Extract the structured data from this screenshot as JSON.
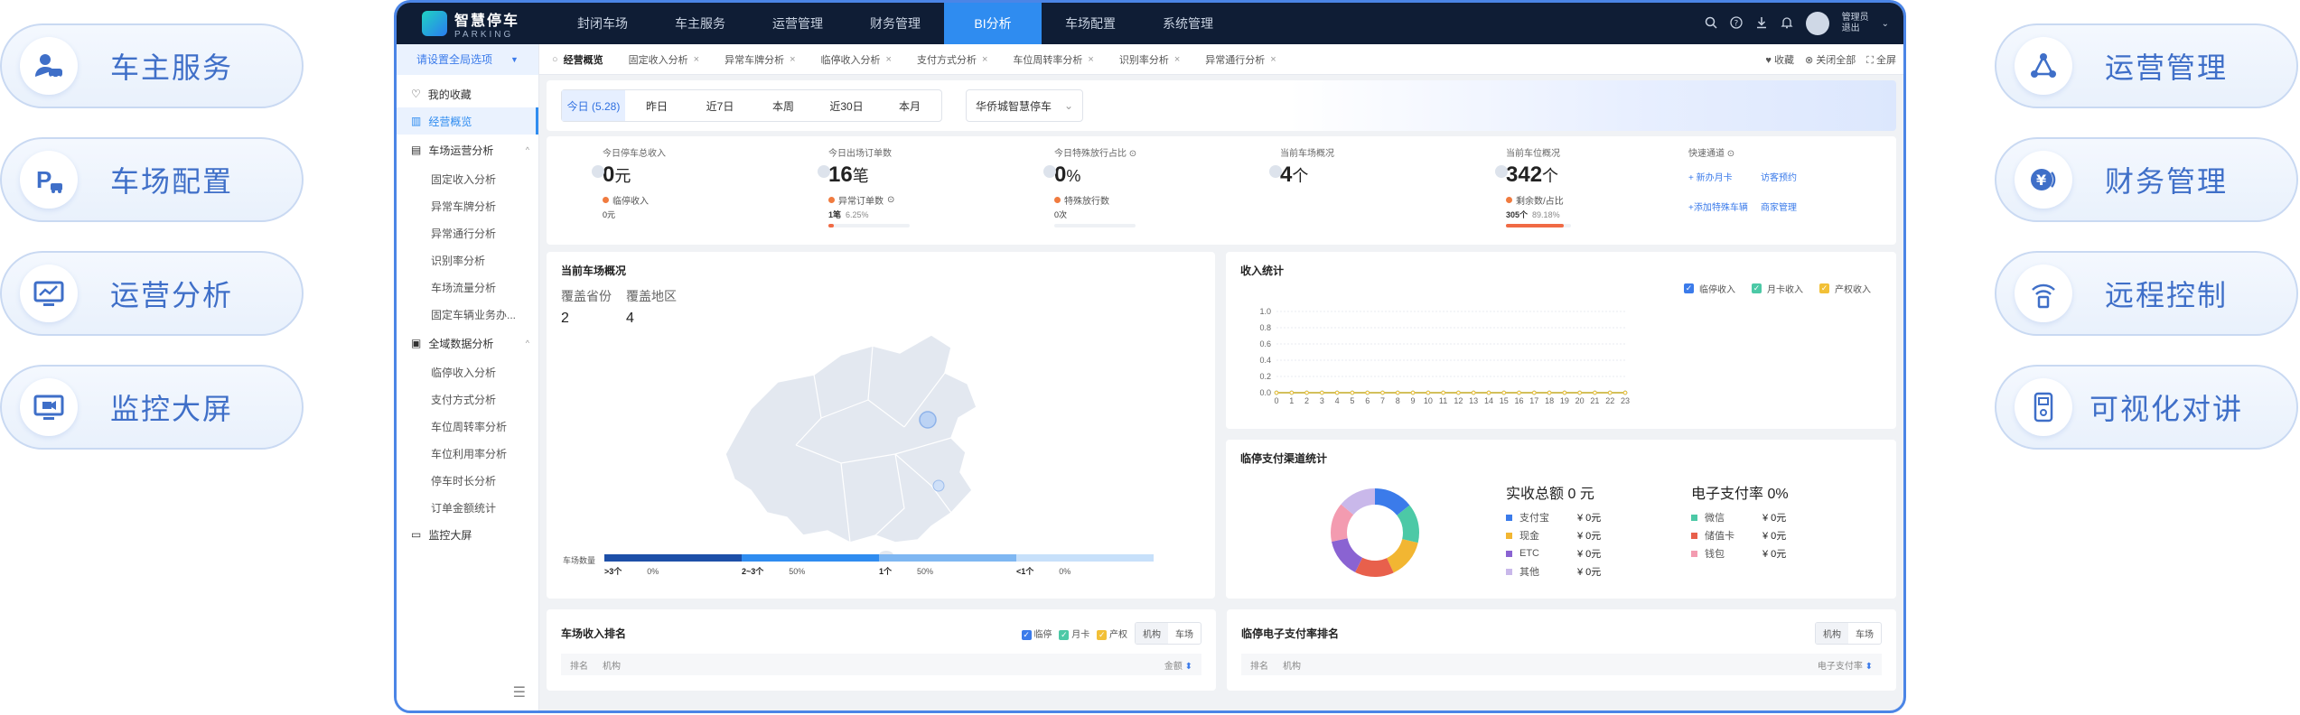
{
  "left_pills": [
    {
      "label": "车主服务",
      "icon": "user-car-icon"
    },
    {
      "label": "车场配置",
      "icon": "parking-car-icon"
    },
    {
      "label": "运营分析",
      "icon": "monitor-chart-icon"
    },
    {
      "label": "监控大屏",
      "icon": "monitor-camera-icon"
    }
  ],
  "right_pills": [
    {
      "label": "运营管理",
      "icon": "network-nodes-icon"
    },
    {
      "label": "财务管理",
      "icon": "yen-coin-icon"
    },
    {
      "label": "远程控制",
      "icon": "remote-signal-icon"
    },
    {
      "label": "可视化对讲",
      "icon": "intercom-icon"
    }
  ],
  "brand": {
    "name": "智慧停车",
    "sub": "PARKING"
  },
  "top_menu": [
    "封闭车场",
    "车主服务",
    "运营管理",
    "财务管理",
    "BI分析",
    "车场配置",
    "系统管理"
  ],
  "top_menu_active": "BI分析",
  "user": {
    "line1": "管理员",
    "line2": "退出"
  },
  "scope_select": "请设置全局选项",
  "tabs": [
    {
      "label": "经营概览",
      "active": true
    },
    {
      "label": "固定收入分析"
    },
    {
      "label": "异常车牌分析"
    },
    {
      "label": "临停收入分析"
    },
    {
      "label": "支付方式分析"
    },
    {
      "label": "车位周转率分析"
    },
    {
      "label": "识别率分析"
    },
    {
      "label": "异常通行分析"
    }
  ],
  "tab_actions": [
    "收藏",
    "关闭全部",
    "全屏"
  ],
  "sidebar": {
    "fav": "我的收藏",
    "overview": "经营概览",
    "group1": {
      "label": "车场运营分析",
      "items": [
        "固定收入分析",
        "异常车牌分析",
        "异常通行分析",
        "识别率分析",
        "车场流量分析",
        "固定车辆业务办..."
      ]
    },
    "group2": {
      "label": "全域数据分析",
      "items": [
        "临停收入分析",
        "支付方式分析",
        "车位周转率分析",
        "车位利用率分析",
        "停车时长分析",
        "订单金额统计"
      ]
    },
    "monitor": "监控大屏"
  },
  "filters": {
    "dates": [
      "今日 (5.28)",
      "昨日",
      "近7日",
      "本周",
      "近30日",
      "本月"
    ],
    "active_date": "今日 (5.28)",
    "lot": "华侨城智慧停车"
  },
  "kpis": [
    {
      "title": "今日停车总收入",
      "value": "0",
      "unit": "元",
      "sub_label": "临停收入",
      "sub_value": "0元",
      "dot": "#f07b3f"
    },
    {
      "title": "今日出场订单数",
      "value": "16",
      "unit": "笔",
      "sub_label": "异常订单数",
      "sub_value": "1笔",
      "sub_pct": "6.25%",
      "bar_pct": 6.25,
      "dot": "#f07b3f"
    },
    {
      "title": "今日特殊放行占比",
      "value": "0",
      "unit": "%",
      "sub_label": "特殊放行数",
      "sub_value": "0次",
      "dot": "#f07b3f"
    },
    {
      "title": "当前车场概况",
      "value": "4",
      "unit": "个"
    },
    {
      "title": "当前车位概况",
      "value": "342",
      "unit": "个",
      "sub_label": "剩余数/占比",
      "sub_value": "305个",
      "sub_pct": "89.18%",
      "bar_pct": 89.18,
      "dot": "#f07b3f"
    }
  ],
  "quick": {
    "title": "快速通道",
    "links": [
      "+ 新办月卡",
      "访客预约",
      "+添加特殊车辆",
      "商家管理"
    ]
  },
  "map_card": {
    "title": "当前车场概况",
    "cov_labels": [
      "覆盖省份",
      "覆盖地区"
    ],
    "cov_values": [
      "2",
      "4"
    ],
    "legend_title": "车场数量",
    "legend": [
      {
        "range": ">3个",
        "pct": "0%",
        "color": "#1d4fa8"
      },
      {
        "range": "2~3个",
        "pct": "50%",
        "color": "#2f8cf0"
      },
      {
        "range": "1个",
        "pct": "50%",
        "color": "#7fb7f2"
      },
      {
        "range": "<1个",
        "pct": "0%",
        "color": "#c7e0fa"
      }
    ]
  },
  "revenue_card": {
    "title": "收入统计",
    "legend": [
      {
        "name": "临停收入",
        "color": "#3b7bea"
      },
      {
        "name": "月卡收入",
        "color": "#4cc9a6"
      },
      {
        "name": "产权收入",
        "color": "#f2c037"
      }
    ]
  },
  "chart_data": {
    "type": "line",
    "title": "收入统计",
    "x": [
      0,
      1,
      2,
      3,
      4,
      5,
      6,
      7,
      8,
      9,
      10,
      11,
      12,
      13,
      14,
      15,
      16,
      17,
      18,
      19,
      20,
      21,
      22,
      23
    ],
    "yticks": [
      0.0,
      0.2,
      0.4,
      0.6,
      0.8,
      1.0
    ],
    "ylim": [
      0,
      1.0
    ],
    "series": [
      {
        "name": "临停收入",
        "values": [
          0,
          0,
          0,
          0,
          0,
          0,
          0,
          0,
          0,
          0,
          0,
          0,
          0,
          0,
          0,
          0,
          0,
          0,
          0,
          0,
          0,
          0,
          0,
          0
        ]
      },
      {
        "name": "月卡收入",
        "values": [
          0,
          0,
          0,
          0,
          0,
          0,
          0,
          0,
          0,
          0,
          0,
          0,
          0,
          0,
          0,
          0,
          0,
          0,
          0,
          0,
          0,
          0,
          0,
          0
        ]
      },
      {
        "name": "产权收入",
        "values": [
          0,
          0,
          0,
          0,
          0,
          0,
          0,
          0,
          0,
          0,
          0,
          0,
          0,
          0,
          0,
          0,
          0,
          0,
          0,
          0,
          0,
          0,
          0,
          0
        ]
      }
    ],
    "legend": "top-right",
    "grid": true
  },
  "pay_card": {
    "title": "临停支付渠道统计",
    "total_label": "实收总额",
    "total_value": "0 元",
    "erate_label": "电子支付率",
    "erate_value": "0%",
    "left_list": [
      {
        "name": "支付宝",
        "amt": "¥ 0元",
        "color": "#3b7bea"
      },
      {
        "name": "现金",
        "amt": "¥ 0元",
        "color": "#f2b632"
      },
      {
        "name": "ETC",
        "amt": "¥ 0元",
        "color": "#8a63d2"
      },
      {
        "name": "其他",
        "amt": "¥ 0元",
        "color": "#c9b8ea"
      }
    ],
    "right_list": [
      {
        "name": "微信",
        "amt": "¥ 0元",
        "color": "#4cc9a6"
      },
      {
        "name": "储值卡",
        "amt": "¥ 0元",
        "color": "#e8604c"
      },
      {
        "name": "钱包",
        "amt": "¥ 0元",
        "color": "#f39bb0"
      }
    ]
  },
  "rank1": {
    "title": "车场收入排名",
    "checks": [
      "临停",
      "月卡",
      "产权"
    ],
    "toggle": [
      "机构",
      "车场"
    ],
    "cols": [
      "排名",
      "机构"
    ],
    "right_col": "金额"
  },
  "rank2": {
    "title": "临停电子支付率排名",
    "toggle": [
      "机构",
      "车场"
    ],
    "cols": [
      "排名",
      "机构"
    ],
    "right_col": "电子支付率"
  },
  "colors": {
    "accent": "#2f8cf0",
    "nav_bg": "#0f1d35",
    "frame_border": "#4b85e6"
  }
}
